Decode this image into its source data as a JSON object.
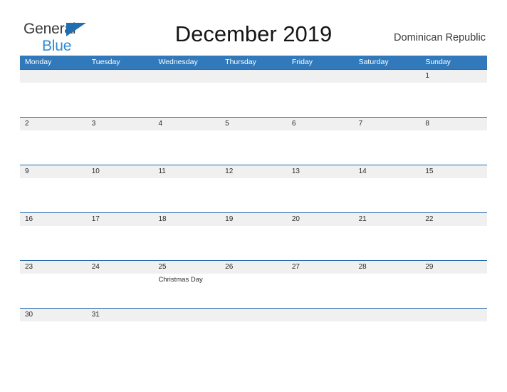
{
  "branding": {
    "logo_text_primary": "General",
    "logo_text_secondary": "Blue",
    "logo_triangle_icon": "blue-triangle-icon",
    "primary_color": "#1f6fb2",
    "secondary_color": "#2e8ad4"
  },
  "header": {
    "title": "December 2019",
    "locale": "Dominican Republic"
  },
  "calendar": {
    "month": "December",
    "year": "2019",
    "header_background_color": "#3179ba",
    "row_border_color": "#2a6cad",
    "day_band_color": "#f0f0f0",
    "weekdays": [
      "Monday",
      "Tuesday",
      "Wednesday",
      "Thursday",
      "Friday",
      "Saturday",
      "Sunday"
    ],
    "weeks": [
      {
        "days": [
          {
            "number": "",
            "event": ""
          },
          {
            "number": "",
            "event": ""
          },
          {
            "number": "",
            "event": ""
          },
          {
            "number": "",
            "event": ""
          },
          {
            "number": "",
            "event": ""
          },
          {
            "number": "",
            "event": ""
          },
          {
            "number": "1",
            "event": ""
          }
        ]
      },
      {
        "days": [
          {
            "number": "2",
            "event": ""
          },
          {
            "number": "3",
            "event": ""
          },
          {
            "number": "4",
            "event": ""
          },
          {
            "number": "5",
            "event": ""
          },
          {
            "number": "6",
            "event": ""
          },
          {
            "number": "7",
            "event": ""
          },
          {
            "number": "8",
            "event": ""
          }
        ]
      },
      {
        "days": [
          {
            "number": "9",
            "event": ""
          },
          {
            "number": "10",
            "event": ""
          },
          {
            "number": "11",
            "event": ""
          },
          {
            "number": "12",
            "event": ""
          },
          {
            "number": "13",
            "event": ""
          },
          {
            "number": "14",
            "event": ""
          },
          {
            "number": "15",
            "event": ""
          }
        ]
      },
      {
        "days": [
          {
            "number": "16",
            "event": ""
          },
          {
            "number": "17",
            "event": ""
          },
          {
            "number": "18",
            "event": ""
          },
          {
            "number": "19",
            "event": ""
          },
          {
            "number": "20",
            "event": ""
          },
          {
            "number": "21",
            "event": ""
          },
          {
            "number": "22",
            "event": ""
          }
        ]
      },
      {
        "days": [
          {
            "number": "23",
            "event": ""
          },
          {
            "number": "24",
            "event": ""
          },
          {
            "number": "25",
            "event": "Christmas Day"
          },
          {
            "number": "26",
            "event": ""
          },
          {
            "number": "27",
            "event": ""
          },
          {
            "number": "28",
            "event": ""
          },
          {
            "number": "29",
            "event": ""
          }
        ]
      },
      {
        "days": [
          {
            "number": "30",
            "event": ""
          },
          {
            "number": "31",
            "event": ""
          },
          {
            "number": "",
            "event": ""
          },
          {
            "number": "",
            "event": ""
          },
          {
            "number": "",
            "event": ""
          },
          {
            "number": "",
            "event": ""
          },
          {
            "number": "",
            "event": ""
          }
        ]
      }
    ]
  }
}
